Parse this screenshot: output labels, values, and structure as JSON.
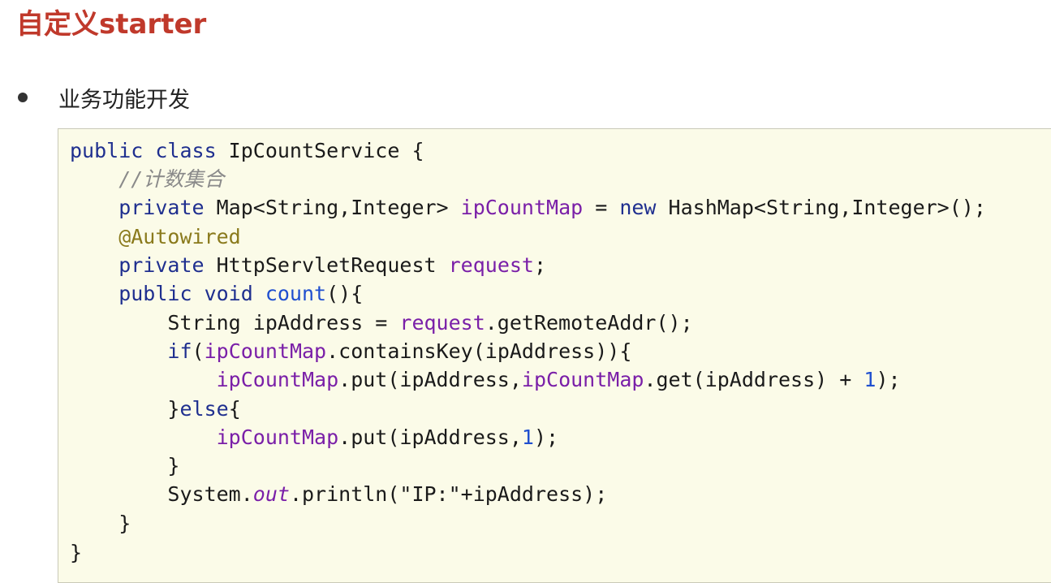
{
  "slide": {
    "title": "自定义starter",
    "bullet": "业务功能开发"
  },
  "colors": {
    "title": "#c0392b",
    "keyword": "#1f2f8f",
    "field": "#7a1fa8",
    "number": "#1f4fcf",
    "comment": "#8a8a8a",
    "annotation": "#8a7a1c",
    "code_background": "#fbfbe8"
  },
  "code": {
    "language": "java",
    "lines": [
      [
        {
          "t": "public class ",
          "c": "kw"
        },
        {
          "t": "IpCountService {",
          "c": "plain"
        }
      ],
      [
        {
          "t": "    //计数集合",
          "c": "cmt"
        }
      ],
      [
        {
          "t": "    private ",
          "c": "kw"
        },
        {
          "t": "Map<String,Integer> ",
          "c": "plain"
        },
        {
          "t": "ipCountMap",
          "c": "fld"
        },
        {
          "t": " = ",
          "c": "plain"
        },
        {
          "t": "new ",
          "c": "kw"
        },
        {
          "t": "HashMap<String,Integer>();",
          "c": "plain"
        }
      ],
      [
        {
          "t": "    @Autowired",
          "c": "ann"
        }
      ],
      [
        {
          "t": "    private ",
          "c": "kw"
        },
        {
          "t": "HttpServletRequest ",
          "c": "plain"
        },
        {
          "t": "request",
          "c": "fld"
        },
        {
          "t": ";",
          "c": "plain"
        }
      ],
      [
        {
          "t": "    public void ",
          "c": "kw"
        },
        {
          "t": "count",
          "c": "num"
        },
        {
          "t": "(){",
          "c": "plain"
        }
      ],
      [
        {
          "t": "        String ipAddress = ",
          "c": "plain"
        },
        {
          "t": "request",
          "c": "fld"
        },
        {
          "t": ".getRemoteAddr();",
          "c": "plain"
        }
      ],
      [
        {
          "t": "        ",
          "c": "plain"
        },
        {
          "t": "if",
          "c": "kw"
        },
        {
          "t": "(",
          "c": "plain"
        },
        {
          "t": "ipCountMap",
          "c": "fld"
        },
        {
          "t": ".containsKey(ipAddress)){",
          "c": "plain"
        }
      ],
      [
        {
          "t": "            ",
          "c": "plain"
        },
        {
          "t": "ipCountMap",
          "c": "fld"
        },
        {
          "t": ".put(ipAddress,",
          "c": "plain"
        },
        {
          "t": "ipCountMap",
          "c": "fld"
        },
        {
          "t": ".get(ipAddress) + ",
          "c": "plain"
        },
        {
          "t": "1",
          "c": "num"
        },
        {
          "t": ");",
          "c": "plain"
        }
      ],
      [
        {
          "t": "        }",
          "c": "plain"
        },
        {
          "t": "else",
          "c": "kw"
        },
        {
          "t": "{",
          "c": "plain"
        }
      ],
      [
        {
          "t": "            ",
          "c": "plain"
        },
        {
          "t": "ipCountMap",
          "c": "fld"
        },
        {
          "t": ".put(ipAddress,",
          "c": "plain"
        },
        {
          "t": "1",
          "c": "num"
        },
        {
          "t": ");",
          "c": "plain"
        }
      ],
      [
        {
          "t": "        }",
          "c": "plain"
        }
      ],
      [
        {
          "t": "        System.",
          "c": "plain"
        },
        {
          "t": "out",
          "c": "itf"
        },
        {
          "t": ".println(\"IP:\"+ipAddress);",
          "c": "plain"
        }
      ],
      [
        {
          "t": "    }",
          "c": "plain"
        }
      ],
      [
        {
          "t": "}",
          "c": "plain"
        }
      ]
    ]
  }
}
